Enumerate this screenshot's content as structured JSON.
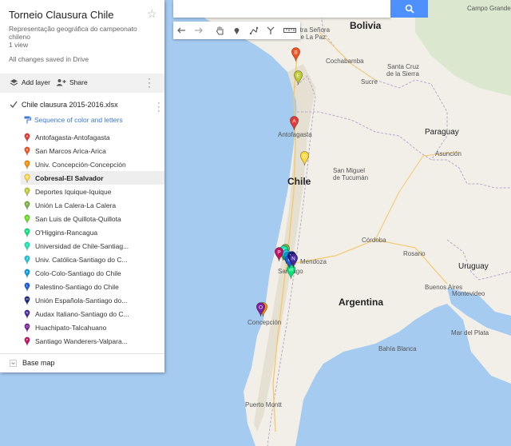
{
  "map_title": "Torneio Clausura Chile",
  "map_description": "Representação geográfica do campeonato chileno",
  "views": "1 view",
  "save_status": "All changes saved in Drive",
  "actions": {
    "add_layer": "Add layer",
    "share": "Share"
  },
  "layer": {
    "name": "Chile clausura 2015-2016.xlsx",
    "style_link": "Sequence of color and letters",
    "items": [
      {
        "label": "Antofagasta-Antofagasta",
        "letter": "A",
        "color": "#e53935"
      },
      {
        "label": "San Marcos Arica-Arica",
        "letter": "B",
        "color": "#f4511e"
      },
      {
        "label": "Univ. Concepción-Concepción",
        "letter": "C",
        "color": "#fb8c00"
      },
      {
        "label": "Cobresal-El Salvador",
        "letter": "D",
        "color": "#fdd835"
      },
      {
        "label": "Deportes Iquique-Iquique",
        "letter": "E",
        "color": "#c0ca33"
      },
      {
        "label": "Unión La Calera-La Calera",
        "letter": "F",
        "color": "#7cb342"
      },
      {
        "label": "San Luis de Quillota-Quillota",
        "letter": "G",
        "color": "#64dd17"
      },
      {
        "label": "O'Higgins-Rancagua",
        "letter": "H",
        "color": "#00e676"
      },
      {
        "label": "Universidad de Chile-Santiag...",
        "letter": "I",
        "color": "#1de9b6"
      },
      {
        "label": "Univ. Católica-Santiago do C...",
        "letter": "J",
        "color": "#26c6da"
      },
      {
        "label": "Colo-Colo-Santiago do Chile",
        "letter": "K",
        "color": "#039be5"
      },
      {
        "label": "Palestino-Santiago do Chile",
        "letter": "L",
        "color": "#1e5fd8"
      },
      {
        "label": "Unión Española-Santiago do...",
        "letter": "M",
        "color": "#1a237e"
      },
      {
        "label": "Audax Italiano-Santiago do C...",
        "letter": "N",
        "color": "#4527a0"
      },
      {
        "label": "Huachipato-Talcahuano",
        "letter": "O",
        "color": "#7b1fa2"
      },
      {
        "label": "Santiago Wanderers-Valpara...",
        "letter": "P",
        "color": "#c51162"
      }
    ],
    "selected_index": 3
  },
  "base_map_label": "Base map",
  "search": {
    "value": "",
    "placeholder": ""
  },
  "map_labels": {
    "bolivia": "Bolivia",
    "chile": "Chile",
    "argentina": "Argentina",
    "paraguay": "Paraguay",
    "uruguay": "Uruguay",
    "nuestra_senora": "Nuestra Señora",
    "de_la_paz": "de La Paz",
    "cochabamba": "Cochabamba",
    "santa_cruz": "Santa Cruz",
    "de_la_sierra": "de la Sierra",
    "sucre": "Sucre",
    "antofagasta": "Antofagasta",
    "asuncion": "Asunción",
    "san_miguel": "San Miguel",
    "de_tucuman": "de Tucumán",
    "cordoba": "Córdoba",
    "rosario": "Rosario",
    "mendoza": "Mendoza",
    "santiago": "Santiago",
    "buenos_aires": "Buenos Aires",
    "montevideo": "Montevideo",
    "concepcion": "Concepción",
    "puerto_montt": "Puerto Montt",
    "mar_del_plata": "Mar del Plata",
    "bahia_blanca": "Bahía Blanca",
    "campo_grande": "Campo Grande"
  },
  "colors": {
    "accent": "#4d90fe",
    "water": "#a6cbf1",
    "land": "#f2efe9"
  }
}
